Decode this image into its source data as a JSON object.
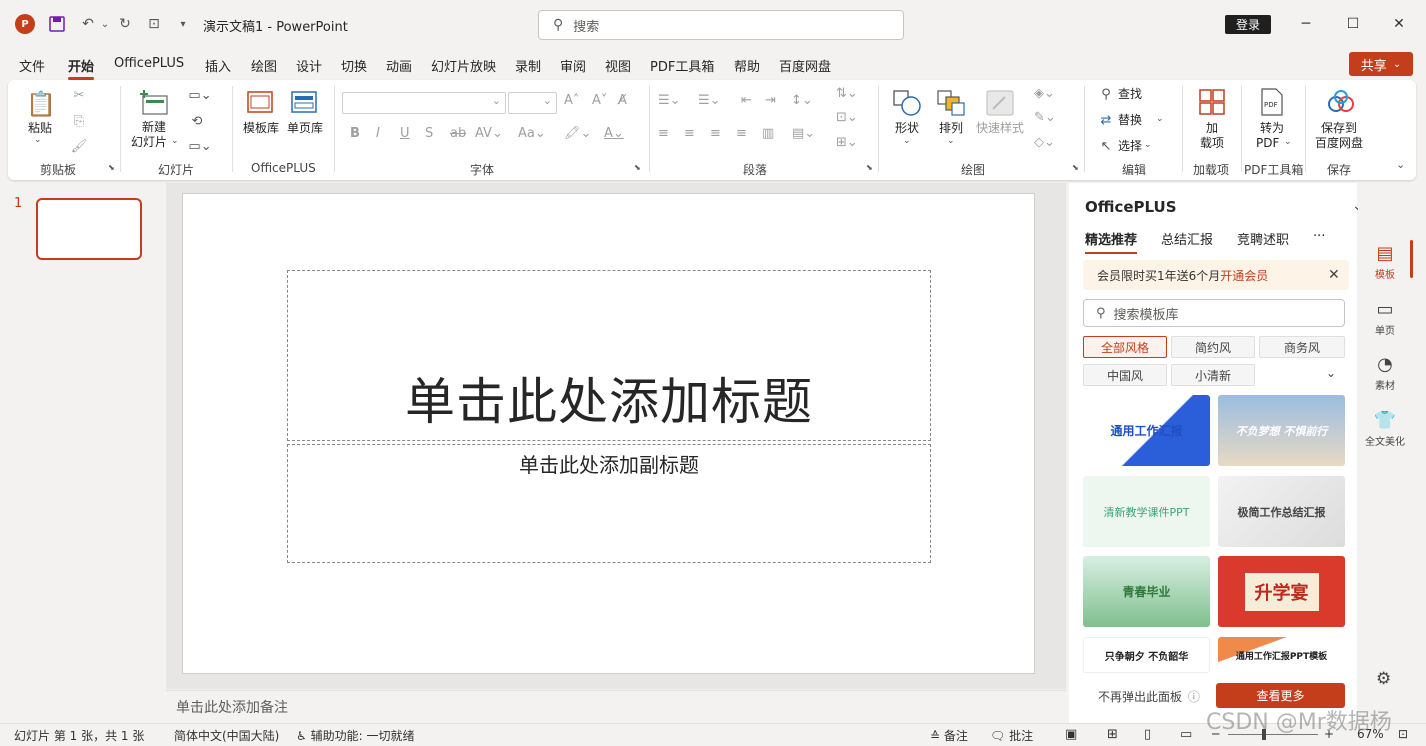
{
  "titlebar": {
    "app_badge": "P",
    "doc_title": "演示文稿1 - PowerPoint",
    "search_placeholder": "搜索",
    "login": "登录"
  },
  "menu": {
    "tabs": [
      "文件",
      "开始",
      "OfficePLUS",
      "插入",
      "绘图",
      "设计",
      "切换",
      "动画",
      "幻灯片放映",
      "录制",
      "审阅",
      "视图",
      "PDF工具箱",
      "帮助",
      "百度网盘"
    ],
    "share": "共享"
  },
  "ribbon": {
    "clipboard": {
      "paste": "粘贴",
      "label": "剪贴板"
    },
    "slides": {
      "new_slide_1": "新建",
      "new_slide_2": "幻灯片",
      "label": "幻灯片"
    },
    "officeplus": {
      "template_lib": "模板库",
      "single_page_lib": "单页库",
      "label": "OfficePLUS"
    },
    "font": {
      "label": "字体"
    },
    "paragraph": {
      "label": "段落"
    },
    "drawing": {
      "shapes": "形状",
      "arrange": "排列",
      "quick_styles": "快速样式",
      "label": "绘图"
    },
    "editing": {
      "find": "查找",
      "replace": "替换",
      "select": "选择",
      "label": "编辑"
    },
    "addins": {
      "addins_1": "加",
      "addins_2": "载项",
      "label": "加载项"
    },
    "pdf": {
      "to_pdf_1": "转为",
      "to_pdf_2": "PDF",
      "label": "PDF工具箱"
    },
    "save": {
      "save_1": "保存到",
      "save_2": "百度网盘",
      "label": "保存"
    }
  },
  "slides_pane": {
    "slide_number": "1"
  },
  "slide": {
    "title_placeholder": "单击此处添加标题",
    "subtitle_placeholder": "单击此处添加副标题",
    "notes_placeholder": "单击此处添加备注"
  },
  "side_panel": {
    "title": "OfficePLUS",
    "tabs": [
      "精选推荐",
      "总结汇报",
      "竞聘述职"
    ],
    "more": "···",
    "promo_text": "会员限时买1年送6个月",
    "promo_link": "开通会员",
    "search_placeholder": "搜索模板库",
    "styles": [
      "全部风格",
      "简约风",
      "商务风",
      "中国风",
      "小清新"
    ],
    "templates": [
      "通用工作汇报",
      "不负梦想 不惧前行",
      "清新教学课件PPT",
      "极简工作总结汇报",
      "青春毕业",
      "升学宴",
      "只争朝夕 不负韶华",
      "通用工作汇报PPT模板"
    ],
    "no_popup": "不再弹出此面板",
    "see_more": "查看更多"
  },
  "icon_rail": [
    "模板",
    "单页",
    "素材",
    "全文美化"
  ],
  "status": {
    "slide_info": "幻灯片 第 1 张，共 1 张",
    "language": "简体中文(中国大陆)",
    "accessibility": "辅助功能: 一切就绪",
    "notes": "备注",
    "comments": "批注",
    "zoom": "67%"
  },
  "watermark": "CSDN @Mr数据杨",
  "colors": {
    "accent": "#c43e1c",
    "ribbon_bg": "#ffffff",
    "chrome_bg": "#f3f2f1"
  }
}
